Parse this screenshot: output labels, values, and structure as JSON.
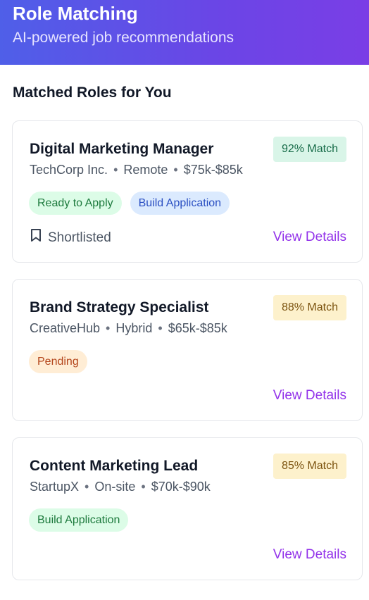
{
  "header": {
    "title": "Role Matching",
    "subtitle": "AI-powered job recommendations"
  },
  "section_title": "Matched Roles for You",
  "roles": [
    {
      "title": "Digital Marketing Manager",
      "company": "TechCorp Inc.",
      "location": "Remote",
      "salary": "$75k-$85k",
      "match": "92% Match",
      "tags": [
        "Ready to Apply",
        "Build Application"
      ],
      "shortlist_label": "Shortlisted",
      "view_label": "View Details"
    },
    {
      "title": "Brand Strategy Specialist",
      "company": "CreativeHub",
      "location": "Hybrid",
      "salary": "$65k-$85k",
      "match": "88% Match",
      "tags": [
        "Pending"
      ],
      "view_label": "View Details"
    },
    {
      "title": "Content Marketing Lead",
      "company": "StartupX",
      "location": "On-site",
      "salary": "$70k-$90k",
      "match": "85% Match",
      "tags": [
        "Build Application"
      ],
      "view_label": "View Details"
    }
  ],
  "colors": {
    "accent": "#9333ea",
    "header_gradient_start": "#4f5fe8",
    "header_gradient_end": "#7a3ee6"
  },
  "icons": {
    "shortlist": "bookmark-icon"
  }
}
